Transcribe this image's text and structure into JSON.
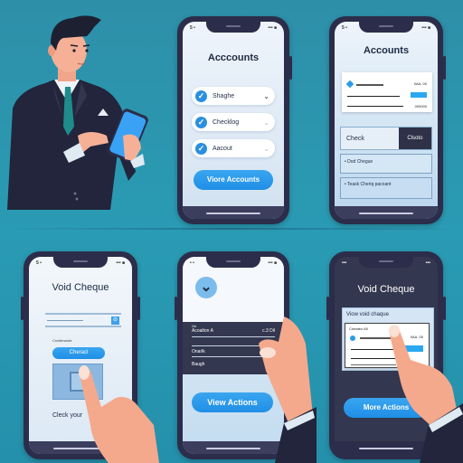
{
  "scene": {
    "description": "Illustration: businessman using banking app; six-panel storyboard of voiding a cheque",
    "colors": {
      "background": "#2a9bb4",
      "phone_frame": "#2b2d4a",
      "accent_blue": "#1f8ee6",
      "text_dark": "#1d2a44"
    }
  },
  "panel1": {
    "figure": "businessman-holding-phone"
  },
  "panel2": {
    "status_left": "5 •",
    "status_right": "••• ■",
    "title": "Acccounts",
    "items": [
      {
        "label": "Shaghe",
        "chevron": "chevron-down-icon"
      },
      {
        "label": "Checklog",
        "chevron": "chevron-down-icon"
      },
      {
        "label": "Aacout",
        "chevron": "chevron-down-icon"
      }
    ],
    "button": "Viore Accounts"
  },
  "panel3": {
    "status_left": "5 •",
    "status_right": "••• ■",
    "title": "Accounts",
    "cheque": {
      "amount": "0AA, 00",
      "amount_words": "000000"
    },
    "tabs": [
      {
        "label": "Check"
      },
      {
        "label": "Clsoto"
      }
    ],
    "options": [
      {
        "label": "• Dod Chegue"
      },
      {
        "label": "• Teask Cheriq pacoant"
      }
    ]
  },
  "panel4": {
    "status_left": "5 •",
    "status_right": "••• ■",
    "title": "Void Cheque",
    "field_label": "Cnctitmarde",
    "button": "Cheracl",
    "footer": "Cleck your"
  },
  "panel5": {
    "status_left": "• •",
    "status_right": "••• ■",
    "panel": {
      "caption": "Oe",
      "row1_label": "Acoalton A",
      "row1_value": "c.3 Dil",
      "row2_label": "Onarlk",
      "row3_label": "Baugh"
    },
    "button": "View Actions"
  },
  "panel6": {
    "status_left": "•••",
    "status_right": "•••",
    "title": "Void Cheque",
    "card_header": "Viow void chaque",
    "cheque": {
      "label": "Cheateo 68",
      "amount": "0AA, 00"
    },
    "button": "More Actions"
  }
}
